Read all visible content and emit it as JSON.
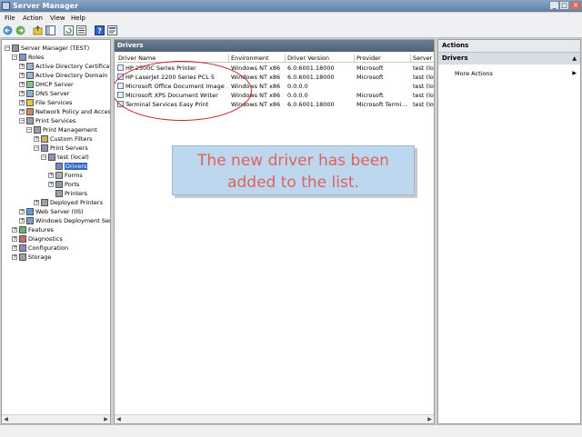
{
  "window": {
    "title": "Server Manager",
    "min": "_",
    "max": "□",
    "close": "✕"
  },
  "menu": [
    "File",
    "Action",
    "View",
    "Help"
  ],
  "tree": [
    {
      "label": "Server Manager (TEST)",
      "indent": 0,
      "exp": "−",
      "icon": "server-icon"
    },
    {
      "label": "Roles",
      "indent": 1,
      "exp": "−",
      "icon": "roles-icon"
    },
    {
      "label": "Active Directory Certificate",
      "indent": 2,
      "exp": "+",
      "icon": "ad-icon"
    },
    {
      "label": "Active Directory Domain Se",
      "indent": 2,
      "exp": "+",
      "icon": "ad-icon"
    },
    {
      "label": "DHCP Server",
      "indent": 2,
      "exp": "+",
      "icon": "dhcp-icon"
    },
    {
      "label": "DNS Server",
      "indent": 2,
      "exp": "+",
      "icon": "dns-icon"
    },
    {
      "label": "File Services",
      "indent": 2,
      "exp": "+",
      "icon": "folder-icon"
    },
    {
      "label": "Network Policy and Access",
      "indent": 2,
      "exp": "+",
      "icon": "network-icon"
    },
    {
      "label": "Print Services",
      "indent": 2,
      "exp": "−",
      "icon": "printer-icon"
    },
    {
      "label": "Print Management",
      "indent": 3,
      "exp": "−",
      "icon": "printer-icon"
    },
    {
      "label": "Custom Filters",
      "indent": 4,
      "exp": "+",
      "icon": "filter-icon"
    },
    {
      "label": "Print Servers",
      "indent": 4,
      "exp": "−",
      "icon": "server-icon"
    },
    {
      "label": "test (local)",
      "indent": 5,
      "exp": "−",
      "icon": "server-icon"
    },
    {
      "label": "Drivers",
      "indent": 6,
      "exp": "",
      "icon": "driver-icon",
      "selected": true
    },
    {
      "label": "Forms",
      "indent": 6,
      "exp": "+",
      "icon": "forms-icon"
    },
    {
      "label": "Ports",
      "indent": 6,
      "exp": "+",
      "icon": "ports-icon"
    },
    {
      "label": "Printers",
      "indent": 6,
      "exp": "",
      "icon": "printer-icon"
    },
    {
      "label": "Deployed Printers",
      "indent": 4,
      "exp": "+",
      "icon": "printer-icon"
    },
    {
      "label": "Web Server (IIS)",
      "indent": 2,
      "exp": "+",
      "icon": "web-icon"
    },
    {
      "label": "Windows Deployment Servi",
      "indent": 2,
      "exp": "+",
      "icon": "deploy-icon"
    },
    {
      "label": "Features",
      "indent": 1,
      "exp": "+",
      "icon": "features-icon"
    },
    {
      "label": "Diagnostics",
      "indent": 1,
      "exp": "+",
      "icon": "diagnostics-icon"
    },
    {
      "label": "Configuration",
      "indent": 1,
      "exp": "+",
      "icon": "config-icon"
    },
    {
      "label": "Storage",
      "indent": 1,
      "exp": "+",
      "icon": "storage-icon"
    }
  ],
  "center": {
    "header": "Drivers",
    "columns": [
      "Driver Name",
      "Environment",
      "Driver Version",
      "Provider",
      "Server N"
    ],
    "rows": [
      [
        "HP 2500C Series Printer",
        "Windows NT x86",
        "6.0.6001.18000",
        "Microsoft",
        "test (lo"
      ],
      [
        "HP LaserJet 2200 Series PCL 5",
        "Windows NT x86",
        "6.0.6001.18000",
        "Microsoft",
        "test (lo"
      ],
      [
        "Microsoft Office Document Image ...",
        "Windows NT x86",
        "0.0.0.0",
        "",
        "test (lo"
      ],
      [
        "Microsoft XPS Document Writer",
        "Windows NT x86",
        "0.0.0.0",
        "Microsoft",
        "test (lo"
      ],
      [
        "Terminal Services Easy Print",
        "Windows NT x86",
        "6.0.6001.18000",
        "Microsoft Termi...",
        "test (lo"
      ]
    ]
  },
  "actions": {
    "header": "Actions",
    "section": "Drivers",
    "more": "More Actions"
  },
  "callout": {
    "line1": "The new driver has been",
    "line2": "added to the list."
  }
}
